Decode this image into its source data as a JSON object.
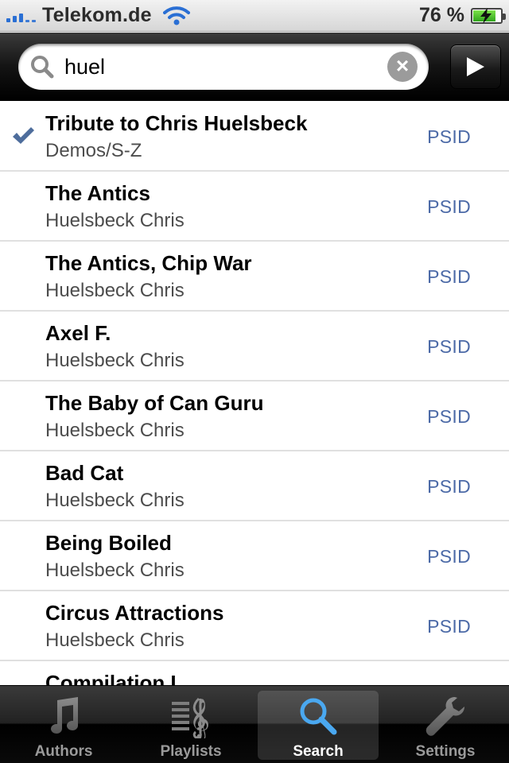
{
  "status_bar": {
    "carrier": "Telekom.de",
    "battery_percent": "76 %"
  },
  "search": {
    "query": "huel"
  },
  "results": [
    {
      "title": "Tribute to Chris Huelsbeck",
      "subtitle": "Demos/S-Z",
      "type": "PSID",
      "checked": true
    },
    {
      "title": "The Antics",
      "subtitle": "Huelsbeck Chris",
      "type": "PSID",
      "checked": false
    },
    {
      "title": "The Antics, Chip War",
      "subtitle": "Huelsbeck Chris",
      "type": "PSID",
      "checked": false
    },
    {
      "title": "Axel F.",
      "subtitle": "Huelsbeck Chris",
      "type": "PSID",
      "checked": false
    },
    {
      "title": "The Baby of Can Guru",
      "subtitle": "Huelsbeck Chris",
      "type": "PSID",
      "checked": false
    },
    {
      "title": "Bad Cat",
      "subtitle": "Huelsbeck Chris",
      "type": "PSID",
      "checked": false
    },
    {
      "title": "Being Boiled",
      "subtitle": "Huelsbeck Chris",
      "type": "PSID",
      "checked": false
    },
    {
      "title": "Circus Attractions",
      "subtitle": "Huelsbeck Chris",
      "type": "PSID",
      "checked": false
    },
    {
      "title": "Compilation I",
      "subtitle": "",
      "type": "",
      "checked": false
    }
  ],
  "tabs": [
    {
      "label": "Authors",
      "icon": "music-note-icon",
      "active": false
    },
    {
      "label": "Playlists",
      "icon": "playlist-icon",
      "active": false
    },
    {
      "label": "Search",
      "icon": "search-icon",
      "active": true
    },
    {
      "label": "Settings",
      "icon": "wrench-icon",
      "active": false
    }
  ],
  "colors": {
    "signal": "#2a6fd4",
    "type_label": "#4c6aa7",
    "checkmark": "#4e6d9c",
    "active_tab_icon": "#4aa8f0"
  }
}
